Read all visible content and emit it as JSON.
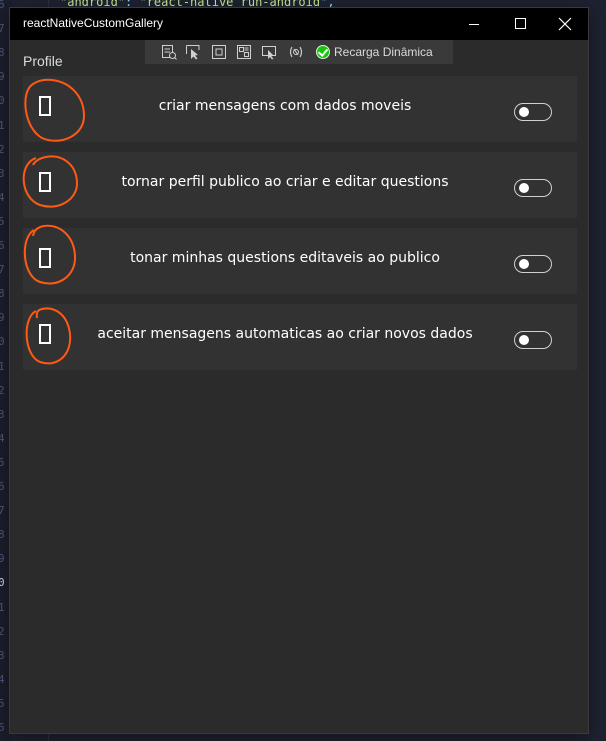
{
  "editor": {
    "code_key": "\"android\"",
    "code_sep": ": ",
    "code_value": "\"react-native run-android",
    "code_end": "\",",
    "gutter_numbers": [
      "6",
      "7",
      "8",
      "9",
      "0",
      "1",
      "2",
      "3",
      "4",
      "5",
      "6",
      "7",
      "8",
      "9",
      "0",
      "1",
      "2",
      "3",
      "4",
      "5",
      "6",
      "7",
      "8",
      "9",
      "0",
      "1",
      "2",
      "3",
      "4",
      "5",
      "6"
    ]
  },
  "window": {
    "title": "reactNativeCustomGallery",
    "minimize_icon": "minimize-icon",
    "maximize_icon": "maximize-icon",
    "close_icon": "close-icon"
  },
  "toolbar": {
    "tools": [
      {
        "name": "live-visual-tree-icon"
      },
      {
        "name": "select-element-icon"
      },
      {
        "name": "display-layout-adorners-icon"
      },
      {
        "name": "track-focused-element-icon"
      },
      {
        "name": "preview-selection-icon"
      },
      {
        "name": "binding-failures-icon"
      }
    ],
    "hot_reload_label": "Recarga Dinâmica",
    "hot_reload_status_color": "#16c60c"
  },
  "page": {
    "header": "Profile"
  },
  "settings": {
    "rows": [
      {
        "label": "criar mensagens com dados moveis",
        "enabled": false
      },
      {
        "label": "tornar perfil publico ao criar e editar questions",
        "enabled": false
      },
      {
        "label": "tonar minhas questions editaveis ao publico",
        "enabled": false
      },
      {
        "label": "aceitar mensagens automaticas ao criar novos dados",
        "enabled": false
      }
    ]
  },
  "colors": {
    "annotation": "#ff5a14",
    "window_bg": "#2b2b2b",
    "row_bg": "#323232"
  }
}
